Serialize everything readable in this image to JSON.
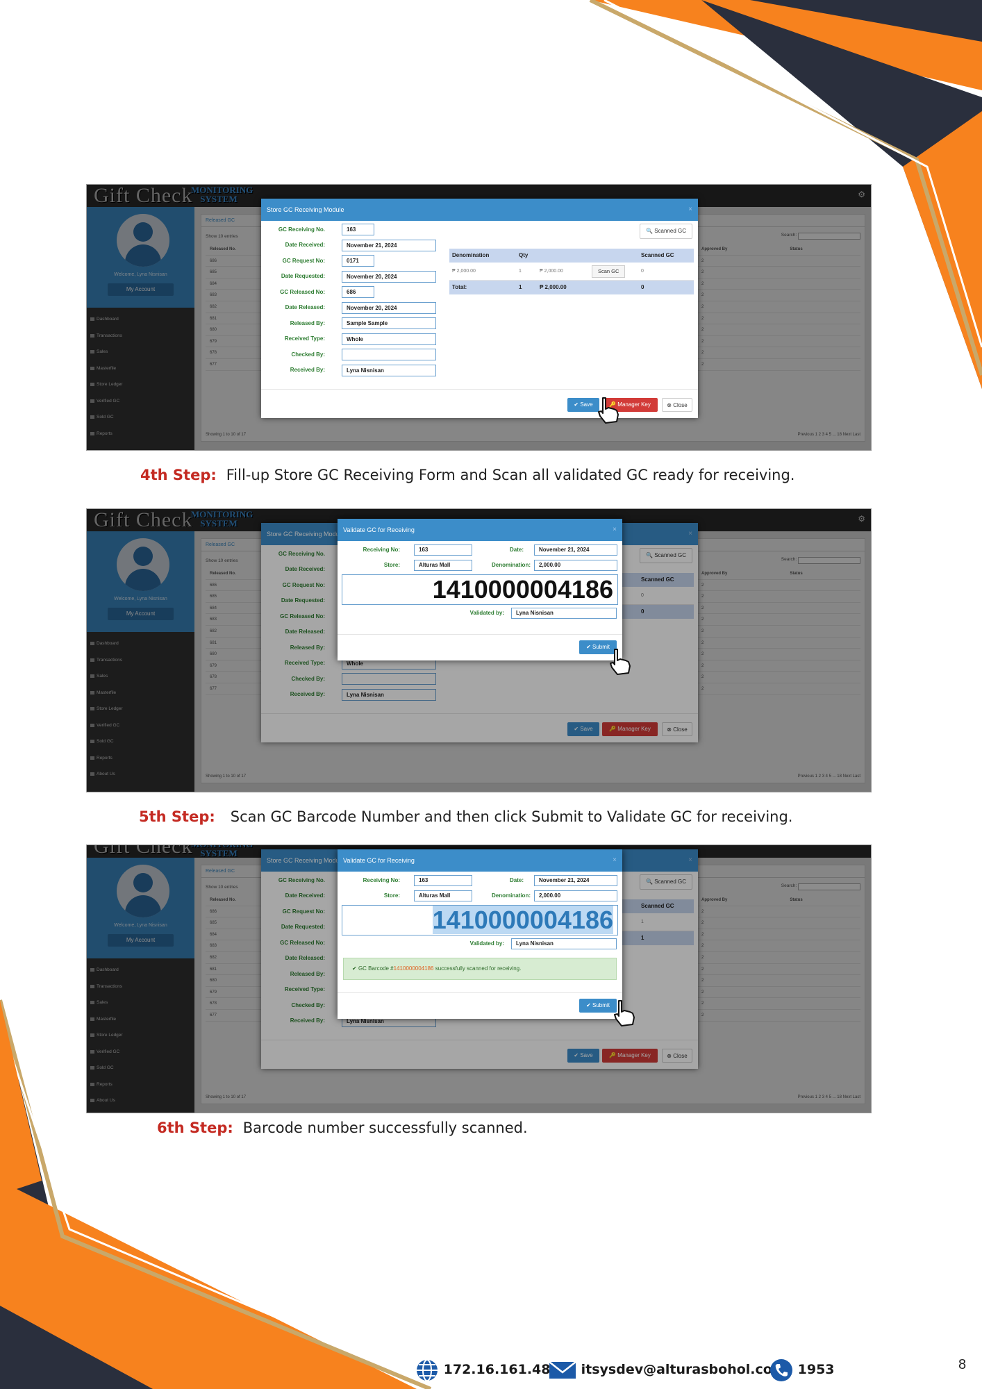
{
  "app": {
    "brand": "Gift Check",
    "brand_sub": "MONITORING SYSTEM",
    "welcome": "Welcome, Lyna Nisnisan",
    "account_button": "My Account",
    "nav": [
      "Dashboard",
      "Transactions",
      "Sales",
      "Masterfile",
      "Store Ledger",
      "Verified GC",
      "Sold GC",
      "Reports",
      "About Us"
    ],
    "list": {
      "tab": "Released GC",
      "show_label": "Show 10 entries",
      "search_label": "Search:",
      "col_released_no": "Released No.",
      "col_approved_by": "Approved By",
      "col_status": "Status",
      "rows": [
        "686",
        "685",
        "684",
        "683",
        "682",
        "681",
        "680",
        "679",
        "678",
        "677"
      ],
      "approved_col": [
        "2",
        "2",
        "2",
        "2",
        "2",
        "2",
        "2",
        "2",
        "2",
        "2"
      ],
      "footer": "Showing 1 to 10 of 17",
      "pager": "Previous  1  2  3  4  5  ...  18  Next  Last"
    }
  },
  "receiving_modal": {
    "title": "Store GC Receiving Module",
    "scanned_button": "Scanned GC",
    "fields": [
      {
        "label": "GC Receiving No.",
        "value": "163"
      },
      {
        "label": "Date Received:",
        "value": "November 21, 2024"
      },
      {
        "label": "GC Request No:",
        "value": "0171"
      },
      {
        "label": "Date Requested:",
        "value": "November 20, 2024"
      },
      {
        "label": "GC Released No:",
        "value": "686"
      },
      {
        "label": "Date Released:",
        "value": "November 20, 2024"
      },
      {
        "label": "Released By:",
        "value": "Sample Sample"
      },
      {
        "label": "Received Type:",
        "value": "Whole"
      },
      {
        "label": "Checked By:",
        "value": ""
      },
      {
        "label": "Received By:",
        "value": "Lyna Nisnisan"
      }
    ],
    "table": {
      "headers": [
        "Denomination",
        "Qty",
        "Scanned GC"
      ],
      "row": {
        "denomination": "₱ 2,000.00",
        "qty": "1",
        "amount": "₱ 2,000.00",
        "scan_button": "Scan GC",
        "scanned_initial": "0",
        "scanned_after": "1"
      },
      "total": {
        "label": "Total:",
        "qty": "1",
        "amount": "₱ 2,000.00",
        "scanned_initial": "0",
        "scanned_after": "1"
      }
    },
    "buttons": {
      "save": "Save",
      "manager_key": "Manager Key",
      "close": "Close"
    }
  },
  "validate_modal": {
    "title": "Validate GC for Receiving",
    "receiving_no_label": "Receiving No:",
    "receiving_no": "163",
    "date_label": "Date:",
    "date": "November 21, 2024",
    "store_label": "Store:",
    "store": "Alturas Mall",
    "denomination_label": "Denomination:",
    "denomination": "2,000.00",
    "barcode": "1410000004186",
    "validated_by_label": "Validated by:",
    "validated_by": "Lyna Nisnisan",
    "success_prefix": "GC Barcode #",
    "success_barcode": "1410000004186",
    "success_suffix": " successfully scanned for receiving.",
    "submit": "Submit"
  },
  "captions": {
    "step4_label": "4th Step:",
    "step4_text": "Fill-up Store GC Receiving Form and Scan all validated GC ready for receiving.",
    "step5_label": "5th Step:",
    "step5_text": "Scan GC Barcode Number and then click Submit to Validate GC for receiving.",
    "step6_label": "6th Step:",
    "step6_text": "Barcode number successfully scanned."
  },
  "footer": {
    "ip": "172.16.161.48",
    "email": "itsysdev@alturasbohol.com",
    "phone": "1953",
    "page_number": "8"
  },
  "colors": {
    "accent_orange": "#f7821e",
    "dark_navy": "#2a2f3d",
    "gold": "#c9a86a",
    "step_red": "#c42a22",
    "ui_blue": "#3c8dc9"
  }
}
